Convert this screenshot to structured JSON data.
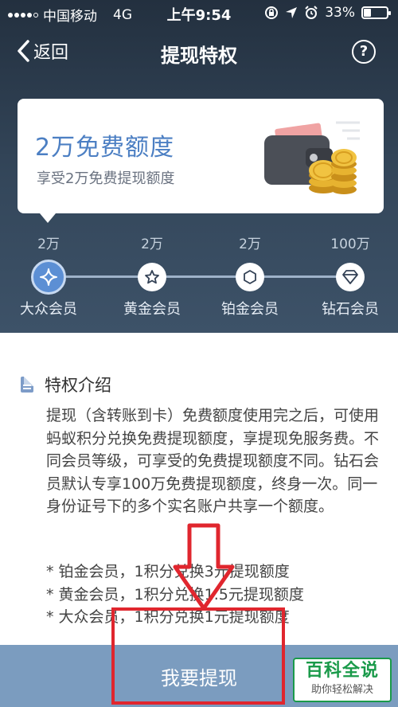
{
  "status_bar": {
    "carrier": "中国移动",
    "network": "4G",
    "time": "上午9:54",
    "battery": "33%",
    "battery_level": 0.33
  },
  "nav": {
    "back_label": "返回",
    "title": "提现特权",
    "help_label": "?"
  },
  "card": {
    "title": "2万免费额度",
    "subtitle": "享受2万免费提现额度"
  },
  "levels": [
    {
      "amount": "2万",
      "name": "大众会员",
      "active": true,
      "icon": "sparkle-icon"
    },
    {
      "amount": "2万",
      "name": "黄金会员",
      "active": false,
      "icon": "star-icon"
    },
    {
      "amount": "2万",
      "name": "铂金会员",
      "active": false,
      "icon": "hexagon-icon"
    },
    {
      "amount": "100万",
      "name": "钻石会员",
      "active": false,
      "icon": "diamond-icon"
    }
  ],
  "privilege": {
    "title": "特权介绍",
    "description": "提现（含转账到卡）免费额度使用完之后，可使用蚂蚁积分兑换免费提现额度，享提现免服务费。不同会员等级，可享受的免费提现额度不同。钻石会员默认专享100万免费提现额度，终身一次。同一身份证号下的多个实名账户共享一个额度。",
    "bullets": [
      "* 铂金会员，1积分兑换3元提现额度",
      "* 黄金会员，1积分兑换1.5元提现额度",
      "* 大众会员，1积分兑换1元提现额度"
    ]
  },
  "cta": {
    "label": "我要提现"
  },
  "watermark": {
    "line1": "百科全说",
    "line2": "助你轻松解决"
  },
  "colors": {
    "header_bg": "#2b3a4b",
    "accent_blue": "#4c7fc3",
    "button_bg": "#7b9cbf",
    "annotation_red": "#e0262e"
  }
}
